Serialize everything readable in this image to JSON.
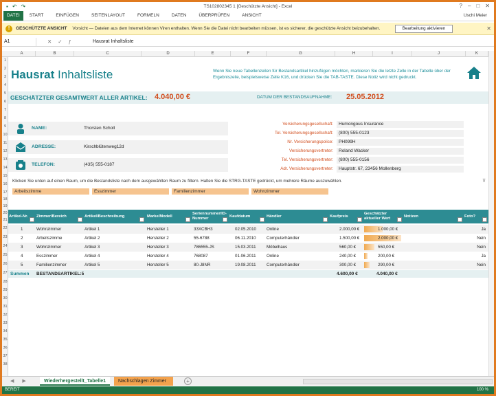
{
  "window": {
    "title": "TS102802345 1 [Geschützte Ansicht] - Excel",
    "user": "Uschi Meier"
  },
  "ribbon": {
    "tabs": [
      "DATEI",
      "START",
      "EINFÜGEN",
      "SEITENLAYOUT",
      "FORMELN",
      "DATEN",
      "ÜBERPRÜFEN",
      "ANSICHT"
    ]
  },
  "protected": {
    "label": "GESCHÜTZTE ANSICHT",
    "message": "Vorsicht — Dateien aus dem Internet können Viren enthalten. Wenn Sie die Datei nicht bearbeiten müssen, ist es sicherer, die geschützte Ansicht beizubehalten.",
    "button": "Bearbeitung aktivieren"
  },
  "formula": {
    "namebox": "A1",
    "value": "Hausrat Inhaltsliste"
  },
  "columns": [
    "A",
    "B",
    "C",
    "D",
    "E",
    "F",
    "G",
    "H",
    "I",
    "J",
    "K"
  ],
  "rows": [
    "1",
    "2",
    "3",
    "4",
    "5",
    "6",
    "7",
    "8",
    "9",
    "10",
    "11",
    "12",
    "13",
    "14",
    "15",
    "16",
    "17",
    "18",
    "19",
    "20",
    "21",
    "22",
    "23",
    "24",
    "25",
    "26",
    "27",
    "28",
    "29",
    "30",
    "31",
    "32",
    "33",
    "34",
    "35",
    "36",
    "37",
    "38"
  ],
  "sheet": {
    "title_bold": "Hausrat",
    "title_rest": " Inhaltsliste",
    "intro": "Wenn Sie neue Tabellenzeilen für Bestandsartikel hinzufügen möchten, markieren Sie die letzte Zelle in der Tabelle über der Ergebniszeile, beispielsweise Zelle K16, und drücken Sie die TAB-TASTE. Diese Notiz wird nicht gedruckt.",
    "total_label": "GESCHÄTZTER GESAMTWERT ALLER ARTIKEL:",
    "total_value": "4.040,00 €",
    "date_label": "DATUM DER BESTANDSAUFNAHME:",
    "date_value": "25.05.2012",
    "name_label": "NAME:",
    "name_value": "Thorsten Scholl",
    "address_label": "ADRESSE:",
    "address_value": "Kirschblütenweg12d",
    "phone_label": "TELEFON:",
    "phone_value": "(435) 555-0187",
    "insurance": [
      {
        "k": "Versicherungsgesellschaft:",
        "v": "Humongous Insurance"
      },
      {
        "k": "Tel. Versicherungsgesellschaft:",
        "v": "(800) 555-0123"
      },
      {
        "k": "Nr. Versicherungspolice:",
        "v": "PH099H"
      },
      {
        "k": "Versicherungsvertreter:",
        "v": "Roland Wacker"
      },
      {
        "k": "Tel. Versicherungsvertreter:",
        "v": "(800) 555-0156"
      },
      {
        "k": "Adr. Versicherungsvertreter:",
        "v": "Hauptstr. 67, 23456 Mollenberg"
      }
    ],
    "hint": "Klicken Sie unten auf einen Raum, um die Bestandsliste nach dem ausgewählten Raum zu filtern. Halten Sie die STRG-TASTE gedrückt, um mehrere Räume auszuwählen.",
    "rooms": [
      "Arbeitszimme",
      "Esszimmer",
      "Familienzimmer",
      "Wohnzimmer"
    ],
    "headers": [
      "Artikel-Nr.",
      "Zimmer/Bereich",
      "Artikel/Beschreibung",
      "Marke/Modell",
      "Seriennummer/ID-Nummer",
      "Kaufdatum",
      "Händler",
      "Kaufpreis",
      "Geschätzter aktueller Wert",
      "Notizen",
      "Foto?"
    ],
    "items": [
      {
        "nr": "1",
        "room": "Wohnzimmer",
        "desc": "Artikel 1",
        "brand": "Hersteller 1",
        "serial": "33XCBH3",
        "date": "02.05.2010",
        "dealer": "Online",
        "price": "2.000,00 €",
        "value": "1.000,00 €",
        "photo": "Ja"
      },
      {
        "nr": "2",
        "room": "Arbeitszimme",
        "desc": "Artikel 2",
        "brand": "Hersteller 2",
        "serial": "55-6788",
        "date": "06.11.2010",
        "dealer": "Computerhändler",
        "price": "1.500,00 €",
        "value": "2.000,00 €",
        "photo": "Nein"
      },
      {
        "nr": "3",
        "room": "Wohnzimmer",
        "desc": "Artikel 3",
        "brand": "Hersteller 3",
        "serial": "786555-JS",
        "date": "15.03.2011",
        "dealer": "Möbelhaus",
        "price": "560,00 €",
        "value": "550,00 €",
        "photo": "Nein"
      },
      {
        "nr": "4",
        "room": "Esszimmer",
        "desc": "Artikel 4",
        "brand": "Hersteller 4",
        "serial": "768087",
        "date": "01.06.2011",
        "dealer": "Online",
        "price": "240,00 €",
        "value": "200,00 €",
        "photo": "Ja"
      },
      {
        "nr": "5",
        "room": "Familienzimmer",
        "desc": "Artikel 5",
        "brand": "Hersteller 5",
        "serial": "80-J8NR",
        "date": "19.08.2011",
        "dealer": "Computerhändler",
        "price": "300,00 €",
        "value": "290,00 €",
        "photo": "Nein"
      }
    ],
    "value_fill": [
      0.5,
      1.0,
      0.28,
      0.1,
      0.15
    ],
    "sum": {
      "label": "Summen",
      "count": "BESTANDSARTIKEL:5",
      "price": "4.600,00 €",
      "value": "4.040,00 €"
    }
  },
  "tabs": {
    "active": "Wiederhergestellt_Tabelle1",
    "other": "Nachschlagen Zimmer"
  },
  "status": {
    "left": "BEREIT",
    "zoom": "100 %"
  },
  "colors": {
    "accent": "#17808a",
    "header": "#2d8c93",
    "orange": "#d14c1c",
    "excel": "#217346"
  }
}
